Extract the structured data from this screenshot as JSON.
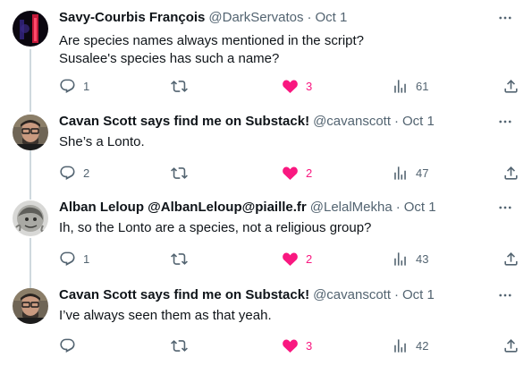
{
  "tweets": [
    {
      "name": "Savy-Courbis François",
      "handle": "@DarkServatos",
      "time": "Oct 1",
      "text": "Are species names always mentioned in the script?\nSusalee's species has such a name?",
      "replies": "1",
      "likes": "3",
      "views": "61"
    },
    {
      "name": "Cavan Scott says find me on Substack!",
      "handle": "@cavanscott",
      "time": "Oct 1",
      "text": "She’s a Lonto.",
      "replies": "2",
      "likes": "2",
      "views": "47"
    },
    {
      "name": "Alban Leloup @AlbanLeloup@piaille.fr",
      "handle": "@LelalMekha",
      "time": "Oct 1",
      "text": "Ih, so the Lonto are a species, not a religious group?",
      "replies": "1",
      "likes": "2",
      "views": "43"
    },
    {
      "name": "Cavan Scott says find me on Substack!",
      "handle": "@cavanscott",
      "time": "Oct 1",
      "text": "I’ve always seen them as that yeah.",
      "replies": "",
      "likes": "3",
      "views": "42"
    }
  ],
  "separator": "·",
  "icons": {
    "reply": "reply-icon",
    "retweet": "retweet-icon",
    "like": "heart-icon",
    "views": "views-icon",
    "share": "share-icon",
    "more": "more-icon"
  },
  "colors": {
    "like_active": "#f91880",
    "secondary_text": "#536471",
    "thread_line": "#cfd9de"
  }
}
